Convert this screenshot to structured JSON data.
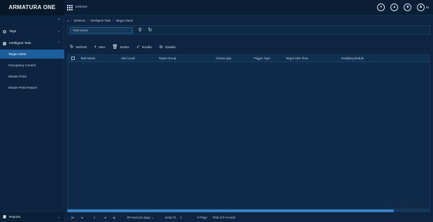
{
  "app": {
    "brand": "ARMATURA ONE",
    "module": "Defense"
  },
  "top_icons": [
    "record-icon",
    "alarm-bell-icon",
    "notification-icon"
  ],
  "user": {
    "initial": "M"
  },
  "sidebar": {
    "groups": [
      {
        "label": "Tags"
      },
      {
        "label": "Intelligent Task"
      }
    ],
    "items": [
      {
        "label": "Target Alerts",
        "active": true
      },
      {
        "label": "Occupancy Control",
        "active": false
      },
      {
        "label": "Muster Point",
        "active": false
      },
      {
        "label": "Muster Point Report",
        "active": false
      }
    ],
    "footer": {
      "label": "Reports"
    }
  },
  "breadcrumb": [
    "Defense",
    "Intelligent Task",
    "Target Alerts"
  ],
  "filter": {
    "placeholder": "Task Name"
  },
  "toolbar": {
    "refresh": "Refresh",
    "new": "New",
    "delete": "Delete",
    "enable": "Enable",
    "disable": "Disable"
  },
  "table": {
    "columns": [
      "Task Name",
      "Alert Level",
      "Target Group",
      "Library type",
      "Trigger Type",
      "Target Alert Time",
      "Enabling Module"
    ],
    "rows": []
  },
  "pager": {
    "page": "1",
    "per_page": "50 rows per page",
    "jump_to": "Jump To",
    "jump_value": "1",
    "pages_label": "/0 Page",
    "total": "Total of 0 records"
  },
  "colors": {
    "accent": "#1d5f9c",
    "background": "#0d2540",
    "scroll_thumb": "#3b82c4"
  }
}
